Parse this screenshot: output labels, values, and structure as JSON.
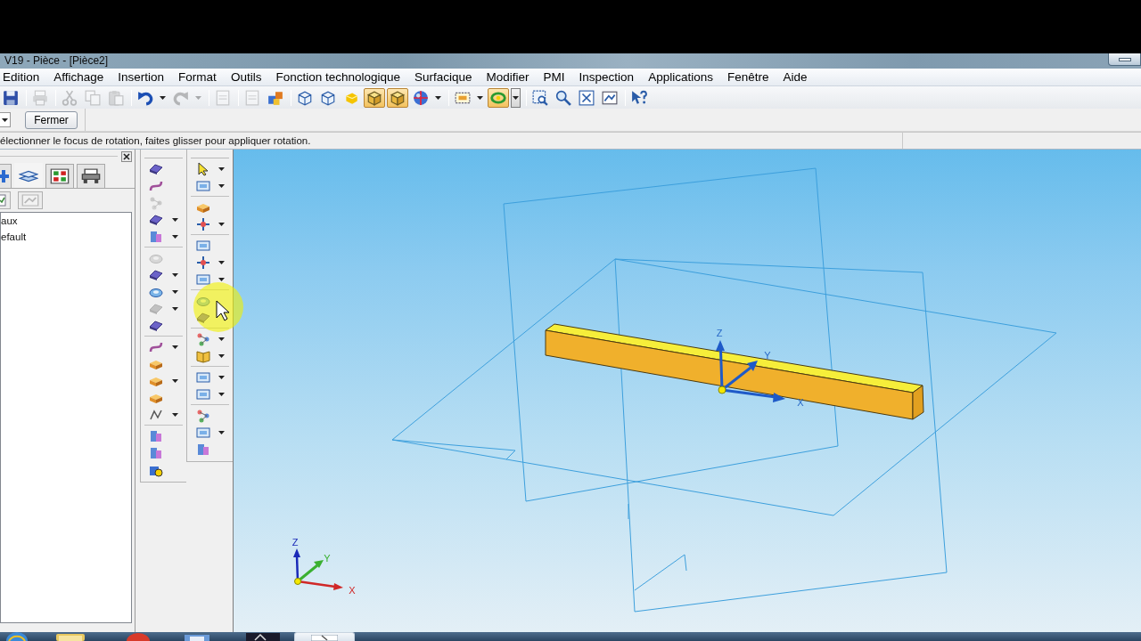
{
  "window": {
    "title": "V19 - Pièce - [Pièce2]"
  },
  "menu_bar": [
    "Edition",
    "Affichage",
    "Insertion",
    "Format",
    "Outils",
    "Fonction technologique",
    "Surfacique",
    "Modifier",
    "PMI",
    "Inspection",
    "Applications",
    "Fenêtre",
    "Aide"
  ],
  "toolbar": [
    [
      {
        "selected": false,
        "disabled": false,
        "dropdown": false
      }
    ],
    [
      {
        "selected": false,
        "disabled": true,
        "dropdown": false
      }
    ],
    [
      {
        "selected": false,
        "disabled": true,
        "dropdown": false
      },
      {
        "selected": false,
        "disabled": true,
        "dropdown": false
      },
      {
        "selected": false,
        "disabled": true,
        "dropdown": false
      }
    ],
    [
      {
        "selected": false,
        "disabled": false,
        "dropdown": true
      },
      {
        "selected": false,
        "disabled": true,
        "dropdown": true
      }
    ],
    [
      {
        "selected": false,
        "disabled": true,
        "dropdown": false
      }
    ],
    [
      {
        "selected": false,
        "disabled": true,
        "dropdown": false
      },
      {
        "selected": false,
        "disabled": false,
        "dropdown": false
      }
    ],
    [
      {
        "selected": false,
        "disabled": false,
        "dropdown": false
      },
      {
        "selected": false,
        "disabled": false,
        "dropdown": false
      },
      {
        "selected": false,
        "disabled": false,
        "dropdown": false
      },
      {
        "selected": true,
        "disabled": false,
        "dropdown": false
      },
      {
        "selected": true,
        "disabled": false,
        "dropdown": false
      },
      {
        "selected": false,
        "disabled": false,
        "dropdown": true
      }
    ],
    [
      {
        "selected": false,
        "disabled": false,
        "dropdown": true
      },
      {
        "selected": true,
        "disabled": false,
        "dropdown": true
      }
    ],
    [
      {
        "selected": false,
        "disabled": false,
        "dropdown": false
      },
      {
        "selected": false,
        "disabled": false,
        "dropdown": false
      },
      {
        "selected": false,
        "disabled": false,
        "dropdown": false
      },
      {
        "selected": false,
        "disabled": false,
        "dropdown": false
      }
    ],
    [
      {
        "selected": false,
        "disabled": false,
        "dropdown": false
      }
    ]
  ],
  "command_bar": {
    "close_button": "Fermer"
  },
  "prompt": "électionner le focus de rotation, faites glisser pour appliquer rotation.",
  "pathfinder": {
    "tabs": [
      {
        "selected": false
      },
      {
        "selected": true
      },
      {
        "selected": false
      },
      {
        "selected": false
      }
    ],
    "tree": [
      "aux",
      "efault"
    ]
  },
  "feature_toolbars": [
    {
      "groups": [
        [
          {
            "dropdown": false,
            "disabled": false
          },
          {
            "dropdown": false,
            "disabled": false
          },
          {
            "dropdown": false,
            "disabled": true
          },
          {
            "dropdown": true,
            "disabled": false
          },
          {
            "dropdown": true,
            "disabled": false
          }
        ],
        [
          {
            "dropdown": false,
            "disabled": true
          },
          {
            "dropdown": true,
            "disabled": false
          },
          {
            "dropdown": true,
            "disabled": false
          },
          {
            "dropdown": true,
            "disabled": true
          },
          {
            "dropdown": false,
            "disabled": false
          }
        ],
        [
          {
            "dropdown": true,
            "disabled": false
          },
          {
            "dropdown": false,
            "disabled": false
          },
          {
            "dropdown": true,
            "disabled": false
          },
          {
            "dropdown": false,
            "disabled": false
          },
          {
            "dropdown": true,
            "disabled": false
          }
        ],
        [
          {
            "dropdown": false,
            "disabled": false
          },
          {
            "dropdown": false,
            "disabled": false
          },
          {
            "dropdown": false,
            "disabled": false
          }
        ]
      ]
    },
    {
      "groups": [
        [
          {
            "dropdown": true,
            "disabled": false
          },
          {
            "dropdown": true,
            "disabled": false
          }
        ],
        [
          {
            "dropdown": false,
            "disabled": false
          },
          {
            "dropdown": true,
            "disabled": false
          }
        ],
        [
          {
            "dropdown": false,
            "disabled": false
          },
          {
            "dropdown": true,
            "disabled": false
          },
          {
            "dropdown": true,
            "disabled": false
          }
        ],
        [
          {
            "dropdown": false,
            "disabled": false
          },
          {
            "dropdown": false,
            "disabled": false
          }
        ],
        [
          {
            "dropdown": true,
            "disabled": false
          },
          {
            "dropdown": true,
            "disabled": false
          }
        ],
        [
          {
            "dropdown": true,
            "disabled": false
          },
          {
            "dropdown": true,
            "disabled": false
          }
        ],
        [
          {
            "dropdown": false,
            "disabled": false
          },
          {
            "dropdown": true,
            "disabled": false
          },
          {
            "dropdown": false,
            "disabled": false
          }
        ]
      ]
    }
  ],
  "viewport": {
    "model_axes": {
      "z": "Z",
      "y": "Y",
      "x": "X"
    },
    "triad": {
      "z": "Z",
      "y": "Y",
      "x": "X"
    }
  }
}
